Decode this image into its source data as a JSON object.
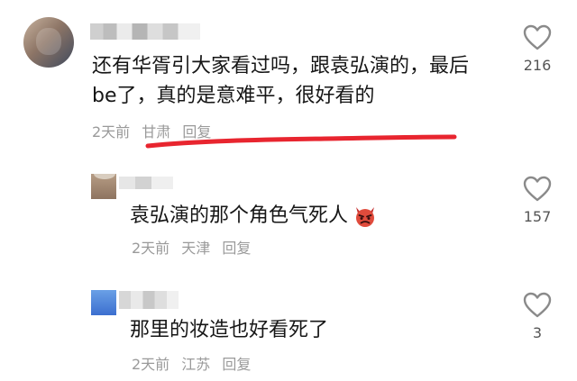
{
  "comments": [
    {
      "text": "还有华胥引大家看过吗，跟袁弘演的，最后be了，真的是意难平，很好看的",
      "time": "2天前",
      "location": "甘肃",
      "reply_label": "回复",
      "likes": "216"
    }
  ],
  "replies": [
    {
      "text": "袁弘演的那个角色气死人",
      "emoji": "angry-devil-icon",
      "time": "2天前",
      "location": "天津",
      "reply_label": "回复",
      "likes": "157"
    },
    {
      "text": "那里的妆造也好看死了",
      "time": "2天前",
      "location": "江苏",
      "reply_label": "回复",
      "likes": "3"
    }
  ],
  "annotation": {
    "underline_color": "#e8252f"
  },
  "colors": {
    "meta_text": "#9a9a9a",
    "body_text": "#161616",
    "like_outline": "#8a8a8a"
  }
}
